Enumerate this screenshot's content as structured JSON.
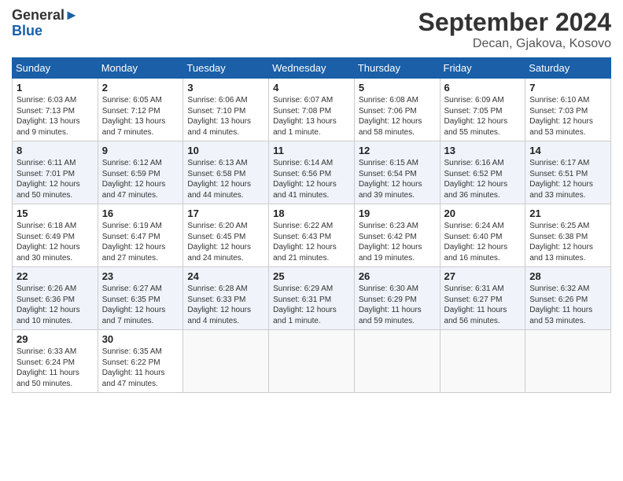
{
  "header": {
    "logo_line1": "General",
    "logo_line2": "Blue",
    "month_year": "September 2024",
    "location": "Decan, Gjakova, Kosovo"
  },
  "weekdays": [
    "Sunday",
    "Monday",
    "Tuesday",
    "Wednesday",
    "Thursday",
    "Friday",
    "Saturday"
  ],
  "weeks": [
    [
      {
        "day": "1",
        "info": "Sunrise: 6:03 AM\nSunset: 7:13 PM\nDaylight: 13 hours\nand 9 minutes."
      },
      {
        "day": "2",
        "info": "Sunrise: 6:05 AM\nSunset: 7:12 PM\nDaylight: 13 hours\nand 7 minutes."
      },
      {
        "day": "3",
        "info": "Sunrise: 6:06 AM\nSunset: 7:10 PM\nDaylight: 13 hours\nand 4 minutes."
      },
      {
        "day": "4",
        "info": "Sunrise: 6:07 AM\nSunset: 7:08 PM\nDaylight: 13 hours\nand 1 minute."
      },
      {
        "day": "5",
        "info": "Sunrise: 6:08 AM\nSunset: 7:06 PM\nDaylight: 12 hours\nand 58 minutes."
      },
      {
        "day": "6",
        "info": "Sunrise: 6:09 AM\nSunset: 7:05 PM\nDaylight: 12 hours\nand 55 minutes."
      },
      {
        "day": "7",
        "info": "Sunrise: 6:10 AM\nSunset: 7:03 PM\nDaylight: 12 hours\nand 53 minutes."
      }
    ],
    [
      {
        "day": "8",
        "info": "Sunrise: 6:11 AM\nSunset: 7:01 PM\nDaylight: 12 hours\nand 50 minutes."
      },
      {
        "day": "9",
        "info": "Sunrise: 6:12 AM\nSunset: 6:59 PM\nDaylight: 12 hours\nand 47 minutes."
      },
      {
        "day": "10",
        "info": "Sunrise: 6:13 AM\nSunset: 6:58 PM\nDaylight: 12 hours\nand 44 minutes."
      },
      {
        "day": "11",
        "info": "Sunrise: 6:14 AM\nSunset: 6:56 PM\nDaylight: 12 hours\nand 41 minutes."
      },
      {
        "day": "12",
        "info": "Sunrise: 6:15 AM\nSunset: 6:54 PM\nDaylight: 12 hours\nand 39 minutes."
      },
      {
        "day": "13",
        "info": "Sunrise: 6:16 AM\nSunset: 6:52 PM\nDaylight: 12 hours\nand 36 minutes."
      },
      {
        "day": "14",
        "info": "Sunrise: 6:17 AM\nSunset: 6:51 PM\nDaylight: 12 hours\nand 33 minutes."
      }
    ],
    [
      {
        "day": "15",
        "info": "Sunrise: 6:18 AM\nSunset: 6:49 PM\nDaylight: 12 hours\nand 30 minutes."
      },
      {
        "day": "16",
        "info": "Sunrise: 6:19 AM\nSunset: 6:47 PM\nDaylight: 12 hours\nand 27 minutes."
      },
      {
        "day": "17",
        "info": "Sunrise: 6:20 AM\nSunset: 6:45 PM\nDaylight: 12 hours\nand 24 minutes."
      },
      {
        "day": "18",
        "info": "Sunrise: 6:22 AM\nSunset: 6:43 PM\nDaylight: 12 hours\nand 21 minutes."
      },
      {
        "day": "19",
        "info": "Sunrise: 6:23 AM\nSunset: 6:42 PM\nDaylight: 12 hours\nand 19 minutes."
      },
      {
        "day": "20",
        "info": "Sunrise: 6:24 AM\nSunset: 6:40 PM\nDaylight: 12 hours\nand 16 minutes."
      },
      {
        "day": "21",
        "info": "Sunrise: 6:25 AM\nSunset: 6:38 PM\nDaylight: 12 hours\nand 13 minutes."
      }
    ],
    [
      {
        "day": "22",
        "info": "Sunrise: 6:26 AM\nSunset: 6:36 PM\nDaylight: 12 hours\nand 10 minutes."
      },
      {
        "day": "23",
        "info": "Sunrise: 6:27 AM\nSunset: 6:35 PM\nDaylight: 12 hours\nand 7 minutes."
      },
      {
        "day": "24",
        "info": "Sunrise: 6:28 AM\nSunset: 6:33 PM\nDaylight: 12 hours\nand 4 minutes."
      },
      {
        "day": "25",
        "info": "Sunrise: 6:29 AM\nSunset: 6:31 PM\nDaylight: 12 hours\nand 1 minute."
      },
      {
        "day": "26",
        "info": "Sunrise: 6:30 AM\nSunset: 6:29 PM\nDaylight: 11 hours\nand 59 minutes."
      },
      {
        "day": "27",
        "info": "Sunrise: 6:31 AM\nSunset: 6:27 PM\nDaylight: 11 hours\nand 56 minutes."
      },
      {
        "day": "28",
        "info": "Sunrise: 6:32 AM\nSunset: 6:26 PM\nDaylight: 11 hours\nand 53 minutes."
      }
    ],
    [
      {
        "day": "29",
        "info": "Sunrise: 6:33 AM\nSunset: 6:24 PM\nDaylight: 11 hours\nand 50 minutes."
      },
      {
        "day": "30",
        "info": "Sunrise: 6:35 AM\nSunset: 6:22 PM\nDaylight: 11 hours\nand 47 minutes."
      },
      {
        "day": "",
        "info": ""
      },
      {
        "day": "",
        "info": ""
      },
      {
        "day": "",
        "info": ""
      },
      {
        "day": "",
        "info": ""
      },
      {
        "day": "",
        "info": ""
      }
    ]
  ]
}
